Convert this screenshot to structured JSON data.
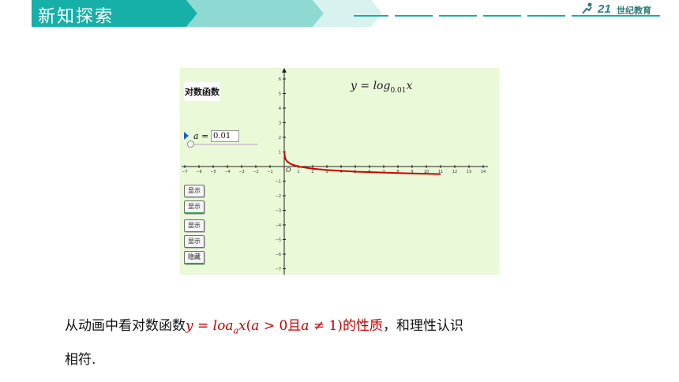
{
  "header": {
    "title": "新知探索",
    "logo_number": "21",
    "logo_text": "世纪教育"
  },
  "applet": {
    "title": "对数函数",
    "formula": {
      "y": "y",
      "eq": " = ",
      "log": "log",
      "base": "0.01",
      "x": "x"
    },
    "slider": {
      "variable": "a =",
      "value": "0.01"
    },
    "buttons": [
      "显示",
      "显示",
      "显示",
      "显示",
      "隐藏"
    ],
    "origin_label": "O"
  },
  "chart_data": {
    "type": "line",
    "function": "y = log_0.01(x)",
    "x_ticks": [
      -7,
      -6,
      -5,
      -4,
      -3,
      -2,
      -1,
      1,
      2,
      3,
      4,
      5,
      6,
      7,
      8,
      9,
      10,
      11,
      12,
      13,
      14
    ],
    "y_ticks": [
      6,
      5,
      4,
      3,
      2,
      1,
      -1,
      -2,
      -3,
      -4,
      -5,
      -6,
      -7
    ],
    "xlim": [
      -7,
      14
    ],
    "ylim": [
      -7,
      6
    ],
    "series": [
      {
        "x": [
          0.01,
          0.02,
          0.05,
          0.1,
          0.2,
          0.5,
          1,
          2,
          3,
          5,
          8,
          11
        ],
        "y": [
          1,
          0.85,
          0.65,
          0.5,
          0.35,
          0.15,
          0,
          -0.15,
          -0.24,
          -0.35,
          -0.45,
          -0.52
        ]
      }
    ],
    "line_color": "#cc0000"
  },
  "caption": {
    "line1_pre": "从动画中看对数函数",
    "y": "y",
    "eq": " = ",
    "loa": "loa",
    "sub": "a",
    "x": "x",
    "paren_open": "(",
    "a1": "a",
    "gt": " > 0且",
    "a2": "a",
    "neq": " ≠ 1)",
    "post_red": "的性质",
    "line1_end": "，和理性认识",
    "line2": "相符."
  }
}
